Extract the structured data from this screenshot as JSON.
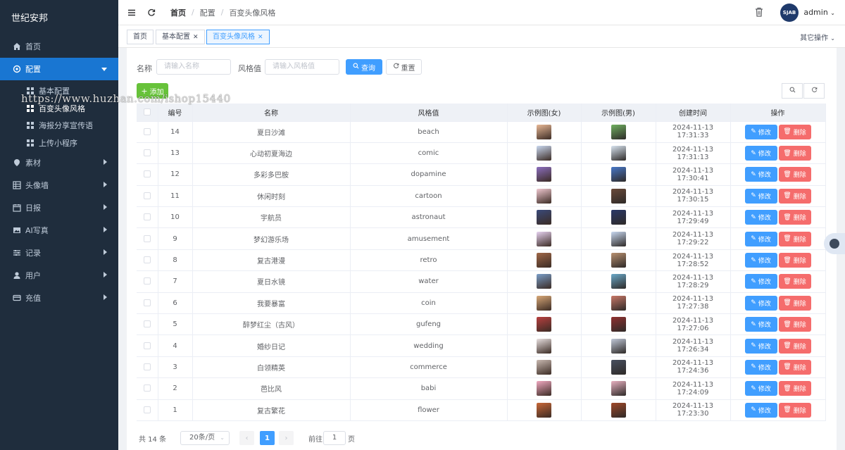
{
  "sidebar": {
    "brand": "世纪安邦",
    "items": [
      {
        "label": "首页",
        "icon": "home-icon"
      },
      {
        "label": "配置",
        "icon": "gear-icon"
      },
      {
        "label": "素材",
        "icon": "pin-icon"
      },
      {
        "label": "头像墙",
        "icon": "table-icon"
      },
      {
        "label": "日报",
        "icon": "calendar-icon"
      },
      {
        "label": "AI写真",
        "icon": "image-icon"
      },
      {
        "label": "记录",
        "icon": "sliders-icon"
      },
      {
        "label": "用户",
        "icon": "user-icon"
      },
      {
        "label": "充值",
        "icon": "card-icon"
      }
    ],
    "sub_items": [
      {
        "label": "基本配置"
      },
      {
        "label": "百变头像风格"
      },
      {
        "label": "海报分享宣传语"
      },
      {
        "label": "上传小程序"
      }
    ]
  },
  "topbar": {
    "breadcrumb": [
      "首页",
      "配置",
      "百变头像风格"
    ],
    "avatar_text": "SJAB",
    "username": "admin"
  },
  "tags": {
    "items": [
      "首页",
      "基本配置",
      "百变头像风格"
    ],
    "more_ops": "其它操作"
  },
  "filter": {
    "name_label": "名称",
    "name_placeholder": "请输入名称",
    "style_label": "风格值",
    "style_placeholder": "请输入风格值",
    "search_label": "查询",
    "reset_label": "重置",
    "add_label": "添加"
  },
  "table": {
    "headers": [
      "编号",
      "名称",
      "风格值",
      "示例图(女)",
      "示例图(男)",
      "创建时间",
      "操作"
    ],
    "edit_label": "修改",
    "delete_label": "删除",
    "rows": [
      {
        "id": "14",
        "name": "夏日沙滩",
        "style": "beach",
        "time": "2024-11-13 17:31:33"
      },
      {
        "id": "13",
        "name": "心动初夏海边",
        "style": "comic",
        "time": "2024-11-13 17:31:13"
      },
      {
        "id": "12",
        "name": "多彩多巴胺",
        "style": "dopamine",
        "time": "2024-11-13 17:30:41"
      },
      {
        "id": "11",
        "name": "休闲时刻",
        "style": "cartoon",
        "time": "2024-11-13 17:30:15"
      },
      {
        "id": "10",
        "name": "宇航员",
        "style": "astronaut",
        "time": "2024-11-13 17:29:49"
      },
      {
        "id": "9",
        "name": "梦幻游乐场",
        "style": "amusement",
        "time": "2024-11-13 17:29:22"
      },
      {
        "id": "8",
        "name": "复古港漫",
        "style": "retro",
        "time": "2024-11-13 17:28:52"
      },
      {
        "id": "7",
        "name": "夏日水镜",
        "style": "water",
        "time": "2024-11-13 17:28:29"
      },
      {
        "id": "6",
        "name": "我要暴富",
        "style": "coin",
        "time": "2024-11-13 17:27:38"
      },
      {
        "id": "5",
        "name": "醉梦红尘（古风）",
        "style": "gufeng",
        "time": "2024-11-13 17:27:06"
      },
      {
        "id": "4",
        "name": "婚纱日记",
        "style": "wedding",
        "time": "2024-11-13 17:26:34"
      },
      {
        "id": "3",
        "name": "白领精英",
        "style": "commerce",
        "time": "2024-11-13 17:24:36"
      },
      {
        "id": "2",
        "name": "芭比风",
        "style": "babi",
        "time": "2024-11-13 17:24:09"
      },
      {
        "id": "1",
        "name": "复古繁花",
        "style": "flower",
        "time": "2024-11-13 17:23:30"
      }
    ]
  },
  "pagination": {
    "total": "共 14 条",
    "page_size": "20条/页",
    "current": "1",
    "goto_label": "前往",
    "goto_value": "1",
    "page_suffix": "页"
  },
  "watermark": "https://www.huzhan.com/ishop15440",
  "colors": {
    "sidebar_bg": "#1f2d3d",
    "active_menu": "#1976d2",
    "primary": "#409eff",
    "danger": "#f56c6c",
    "success": "#67c23a"
  }
}
